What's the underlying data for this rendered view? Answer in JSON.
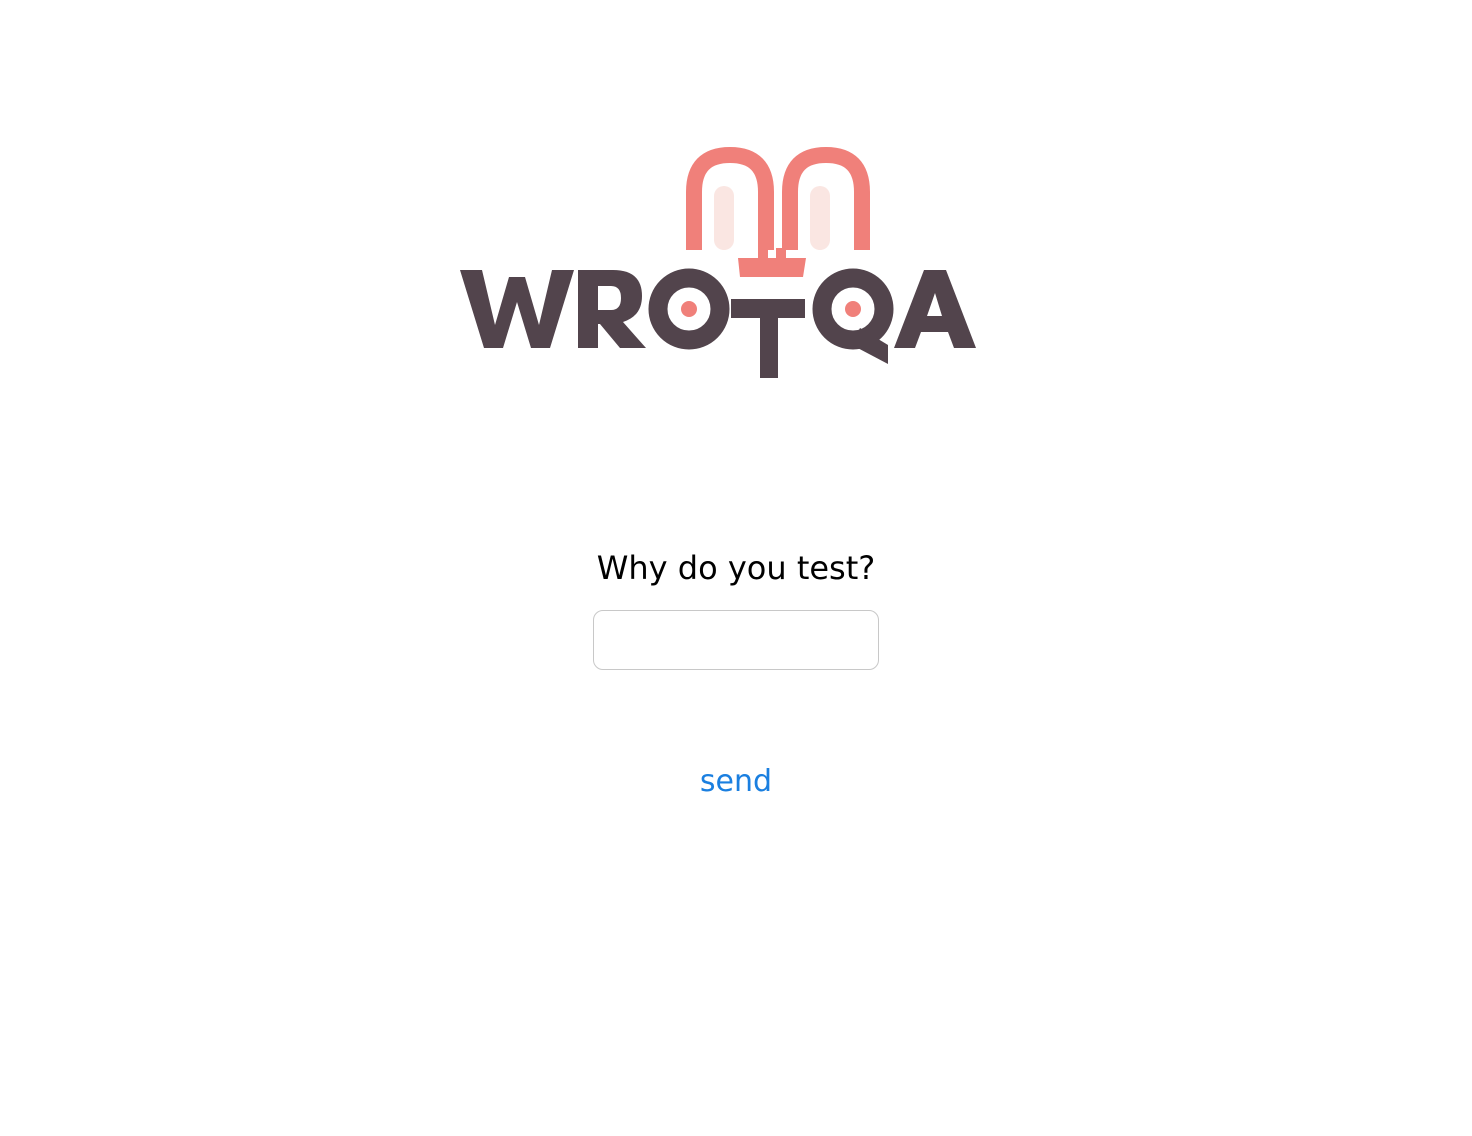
{
  "logo": {
    "wordmark": "WROTQA",
    "letters": [
      "W",
      "R",
      "O",
      "T",
      "Q",
      "A"
    ],
    "colors": {
      "text": "#52444c",
      "ears": "#f0807a",
      "ears_inner": "#fae6e2",
      "eye": "#f0807a"
    }
  },
  "form": {
    "question": "Why do you test?",
    "answer_value": "",
    "answer_placeholder": "",
    "send_label": "send"
  },
  "colors": {
    "accent": "#1a7fe0",
    "input_border": "#c8c8c8",
    "background": "#ffffff"
  }
}
